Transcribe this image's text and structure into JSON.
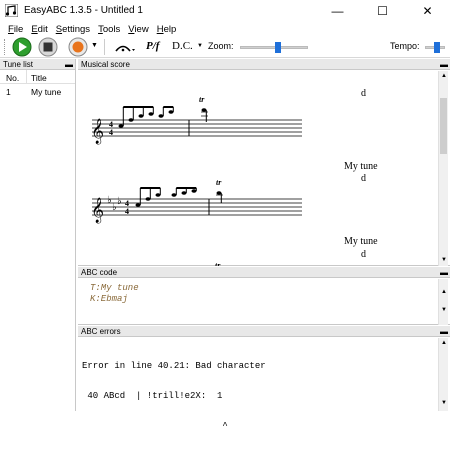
{
  "window": {
    "title": "EasyABC 1.3.5 - Untitled 1",
    "minimize": "—",
    "maximize": "☐",
    "close": "✕"
  },
  "menu": [
    {
      "label": "File",
      "key": "F",
      "rest": "ile"
    },
    {
      "label": "Edit",
      "key": "E",
      "rest": "dit"
    },
    {
      "label": "Settings",
      "key": "S",
      "rest": "ettings"
    },
    {
      "label": "Tools",
      "key": "T",
      "rest": "ools"
    },
    {
      "label": "View",
      "key": "V",
      "rest": "iew"
    },
    {
      "label": "Help",
      "key": "H",
      "rest": "elp"
    }
  ],
  "toolbar": {
    "dynamics": "P/f",
    "dc": "D.C.",
    "zoom_label": "Zoom:",
    "tempo_label": "Tempo:",
    "zoom_level": 0.55,
    "tempo_level": 0.6
  },
  "tune_list": {
    "header": "Tune list",
    "col_no": "No.",
    "col_title": "Title",
    "rows": [
      {
        "no": "1",
        "title": "My tune"
      }
    ]
  },
  "score": {
    "header": "Musical score",
    "label_d1": "d",
    "title2": "My tune",
    "label_d2": "d",
    "title3": "My tune",
    "label_d3": "d",
    "trill": "tr"
  },
  "abc_code": {
    "header": "ABC code",
    "lines": [
      "T:My tune",
      "K:Ebmaj"
    ]
  },
  "abc_errors": {
    "header": "ABC errors",
    "lines": [
      "Error in line 40.21: Bad character",
      " 40 ABcd  | !trill!e2X:  1",
      "                          ^"
    ]
  },
  "colors": {
    "play_green": "#2e9e2e",
    "record_orange": "#e8741c",
    "slider_blue": "#1e6fd9"
  }
}
